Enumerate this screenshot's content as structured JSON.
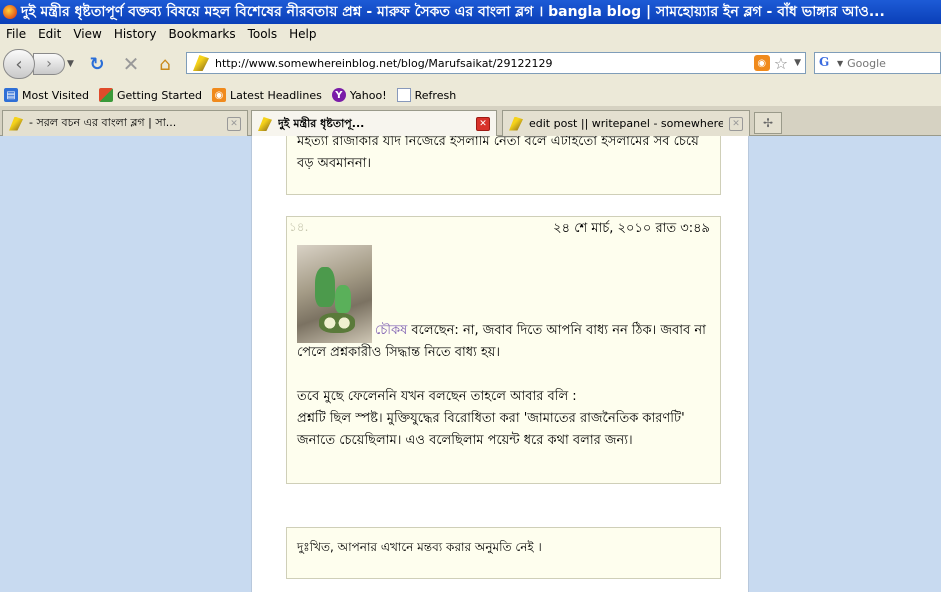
{
  "window": {
    "title": "দুই মন্ত্রীর ধৃষ্টতাপূর্ণ বক্তব্য বিষয়ে মহল বিশেষের নীরবতায় প্রশ্ন - মারুফ সৈকত এর বাংলা ব্লগ । bangla blog | সামহোয়্যার ইন ব্লগ - বাঁধ ভাঙ্গার আও..."
  },
  "menubar": {
    "items": [
      {
        "label": "File"
      },
      {
        "label": "Edit"
      },
      {
        "label": "View"
      },
      {
        "label": "History"
      },
      {
        "label": "Bookmarks"
      },
      {
        "label": "Tools"
      },
      {
        "label": "Help"
      }
    ]
  },
  "navbar": {
    "url": "http://www.somewhereinblog.net/blog/Marufsaikat/29122129",
    "search_placeholder": "Google"
  },
  "bookmarks": {
    "items": [
      {
        "label": "Most Visited"
      },
      {
        "label": "Getting Started"
      },
      {
        "label": "Latest Headlines"
      },
      {
        "label": "Yahoo!"
      },
      {
        "label": "Refresh"
      }
    ]
  },
  "tabs": [
    {
      "label": "- সরল বচন এর বাংলা ব্লগ | সা..."
    },
    {
      "label": "দুই মন্ত্রীর ধৃষ্টতাপূ..."
    },
    {
      "label": "edit post || writepanel - somewhere in...."
    }
  ],
  "comments": {
    "prev_text": "মইত্যা রাজাকার যদি নিজেরে ইসলামি নেতা বলে এটাইতো ইসলামের সব চেয়ে বড় অবমাননা।",
    "item": {
      "number": "১৪.",
      "date": "২৪ শে মার্চ, ২০১০ রাত ৩:৪৯",
      "author": "চৌকষ",
      "lead": "বলেছেন: না, জবাব দিতে আপনি বাধ্য নন ঠিক। জবাব না পেলে প্রশ্নকারীও সিদ্ধান্ত নিতে বাধ্য হয়।",
      "para2": "তবে মুছে ফেলেননি যখন বলছেন তাহলে আবার বলি :",
      "para3": "প্রশ্নটি ছিল স্পষ্ট। মুক্তিযুদ্ধের বিরোধিতা করা 'জামাতের রাজনৈতিক কারণটি' জনাতে চেয়েছিলাম। এও বলেছিলাম পয়েন্ট ধরে কথা বলার জন্য।"
    },
    "no_permission": "দুঃখিত, আপনার এখানে মন্তব্য করার অনুমতি নেই ।"
  }
}
